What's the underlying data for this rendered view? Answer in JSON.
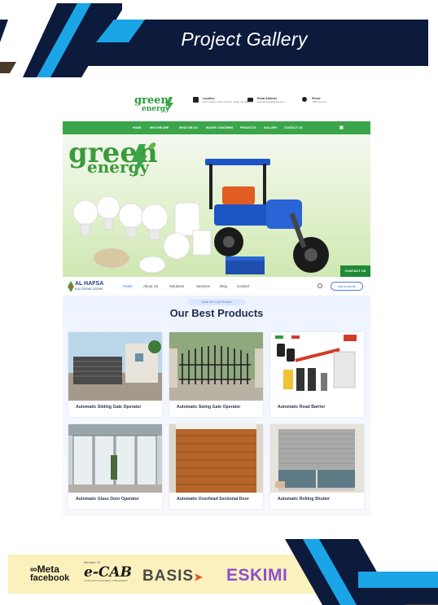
{
  "banner": {
    "title": "Project Gallery"
  },
  "greenenergy_site": {
    "logo_line1": "green",
    "logo_line2": "energy",
    "contacts": [
      {
        "icon": "map-marker-icon",
        "label": "Location",
        "value": "Lorem ipsum dolor sit amet, Road 4 A, Block B"
      },
      {
        "icon": "envelope-icon",
        "label": "Email Address",
        "value": "greenenergy@gmail.com"
      },
      {
        "icon": "phone-icon",
        "label": "Phone",
        "value": "+880-xxxxxxx"
      }
    ],
    "nav": [
      "HOME",
      "WHO WE ARE",
      "WHAT WE DO",
      "WATER CONCERNS",
      "PRODUCTS",
      "GALLERY",
      "CONTACT US"
    ],
    "hero_logo_line1": "green",
    "hero_logo_line2": "energy",
    "contact_button": "CONTACT US"
  },
  "alhafsa_site": {
    "logo_name": "AL HAFSA",
    "logo_sub": "ELECTRONIC DOORS",
    "nav": [
      "Home",
      "About Us",
      "Solutions",
      "Services",
      "Blog",
      "Contact"
    ],
    "quote_button": "Ask a Quote",
    "section_pill": "What We Can Provide",
    "section_title": "Our Best Products",
    "products": [
      "Automatic Sliding Gate Operator",
      "Automatic Swing Gate Operator",
      "Automatic Road Barrier",
      "Automatic Glass Door Operator",
      "Automatic Overhead Sectional Door",
      "Automatic Rolling Shutter"
    ]
  },
  "footer": {
    "meta_line1": "Meta",
    "meta_line2": "facebook",
    "ecab_member": "Member Of",
    "ecab_name": "e-CAB",
    "ecab_sub": "e-Commerce Association of Bangladesh",
    "basis": "BASIS",
    "eskimi": "ESKIMI"
  },
  "colors": {
    "navy": "#0c1a3c",
    "sky_blue": "#1aa5e6",
    "green": "#3aa54a",
    "footer_yellow": "#fbf1bc",
    "eskimi_purple": "#8c4fd0"
  }
}
